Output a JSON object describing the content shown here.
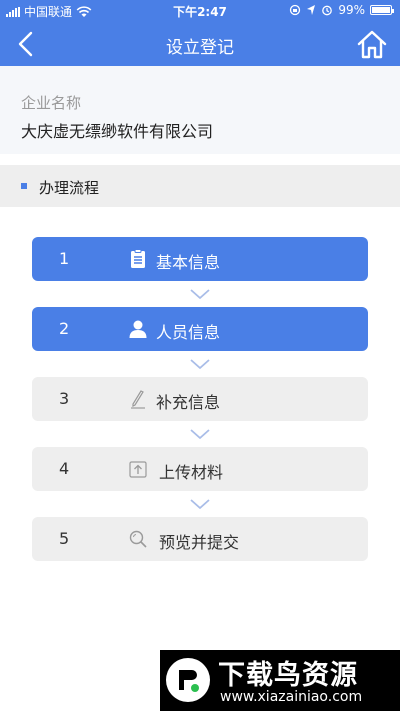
{
  "status_bar": {
    "carrier": "中国联通",
    "time": "下午2:47",
    "battery_text": "99%",
    "battery_level": 0.99
  },
  "nav": {
    "title": "设立登记",
    "back_icon": "chevron-left-icon",
    "home_icon": "home-icon"
  },
  "company": {
    "label": "企业名称",
    "value": "大庆虚无缥缈软件有限公司"
  },
  "process": {
    "title": "办理流程"
  },
  "steps": [
    {
      "num": "1",
      "label": "基本信息",
      "icon": "document-icon",
      "active": true
    },
    {
      "num": "2",
      "label": "人员信息",
      "icon": "person-icon",
      "active": true
    },
    {
      "num": "3",
      "label": "补充信息",
      "icon": "pen-icon",
      "active": false
    },
    {
      "num": "4",
      "label": "上传材料",
      "icon": "upload-icon",
      "active": false
    },
    {
      "num": "5",
      "label": "预览并提交",
      "icon": "search-icon",
      "active": false
    }
  ],
  "watermark": {
    "title": "下载鸟资源",
    "url": "www.xiazainiao.com"
  },
  "colors": {
    "primary": "#4a7fe6",
    "inactive_step": "#eeeeee",
    "chevron": "#a9bde8"
  }
}
